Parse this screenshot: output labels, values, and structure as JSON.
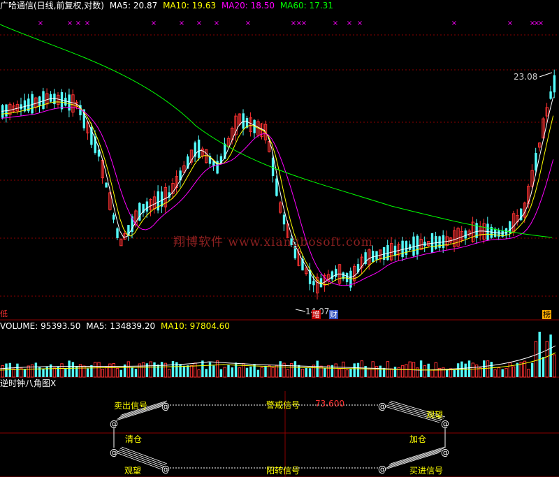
{
  "price_header": {
    "title": "广哈通信(日线,前复权,对数)",
    "ma5": "MA5: 20.87",
    "ma10": "MA10: 19.63",
    "ma20": "MA20: 18.50",
    "ma60": "MA60: 17.31"
  },
  "annotations": {
    "high_price": "23.08",
    "low_price": "14.07",
    "left_tag": "低",
    "tag_zeng": "增",
    "tag_cai": "财",
    "tag_bang": "榜",
    "watermark": "翔博软件 www.xiangbosoft.com"
  },
  "volume_header": {
    "volume": "VOLUME: 95393.50",
    "ma5": "MA5: 134839.20",
    "ma10": "MA10: 97804.60"
  },
  "indicator": {
    "name": "逆时钟八角图X",
    "sell_signal": "卖出信号",
    "warning_signal": "警戒信号",
    "warning_value": "73.600",
    "watch_top": "观望",
    "clear_position": "清仓",
    "add_position": "加仓",
    "watch_bottom": "观望",
    "yang_signal": "阳转信号",
    "buy_signal": "买进信号",
    "at_symbol": "@"
  },
  "colors": {
    "up": "#ff3232",
    "down": "#54ffff",
    "ma5": "#ffffff",
    "ma10": "#ffff00",
    "ma20": "#ff00ff",
    "ma60": "#00ff00",
    "grid": "#8b0000"
  },
  "icons": {
    "cross_markers": "magenta-cross-icon"
  }
}
